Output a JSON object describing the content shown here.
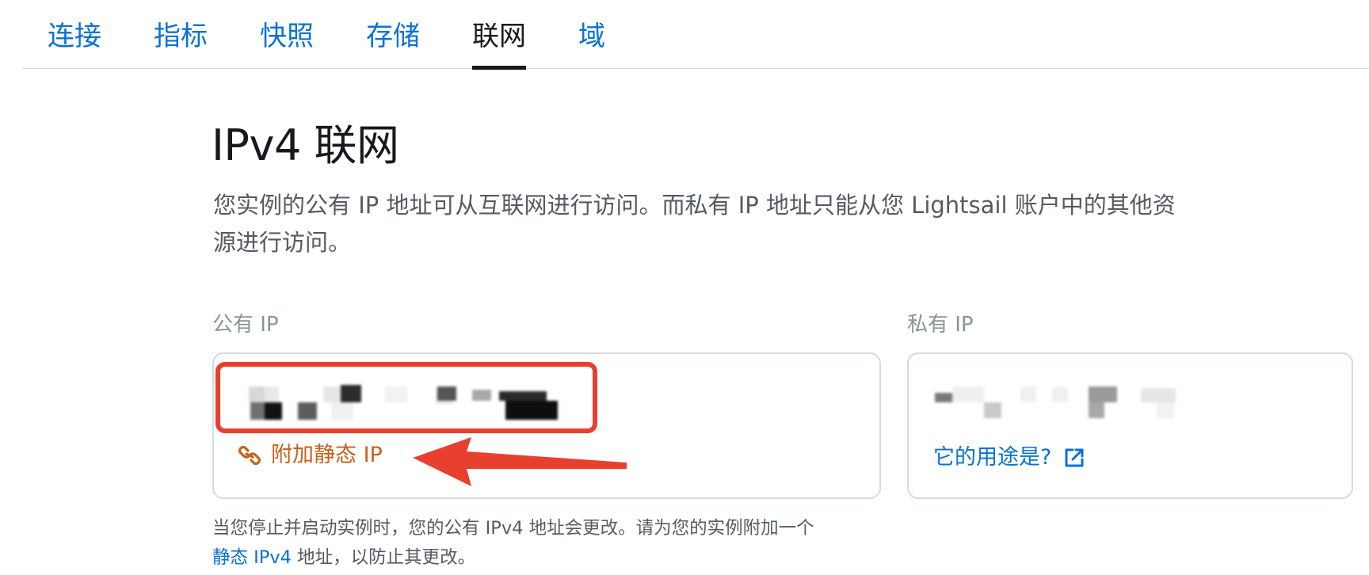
{
  "tabs": [
    {
      "label": "连接"
    },
    {
      "label": "指标"
    },
    {
      "label": "快照"
    },
    {
      "label": "存储"
    },
    {
      "label": "联网",
      "active": true
    },
    {
      "label": "域"
    }
  ],
  "section": {
    "title": "IPv4 联网",
    "description": "您实例的公有 IP 地址可从互联网进行访问。而私有 IP 地址只能从您 Lightsail 账户中的其他资源进行访问。"
  },
  "public_ip": {
    "label": "公有 IP",
    "attach_link": "附加静态 IP",
    "attach_icon": "link-chain-icon"
  },
  "private_ip": {
    "label": "私有 IP",
    "usage_link": "它的用途是?",
    "usage_icon": "external-link-icon"
  },
  "helper": {
    "text_before": "当您停止并启动实例时，您的公有 IPv4 地址会更改。请为您的实例附加一个",
    "link": "静态 IPv4",
    "text_after": " 地址，以防止其更改。"
  },
  "colors": {
    "link": "#0972d3",
    "attach": "#c7611d",
    "annotation": "#e8402f",
    "text": "#16191f"
  }
}
